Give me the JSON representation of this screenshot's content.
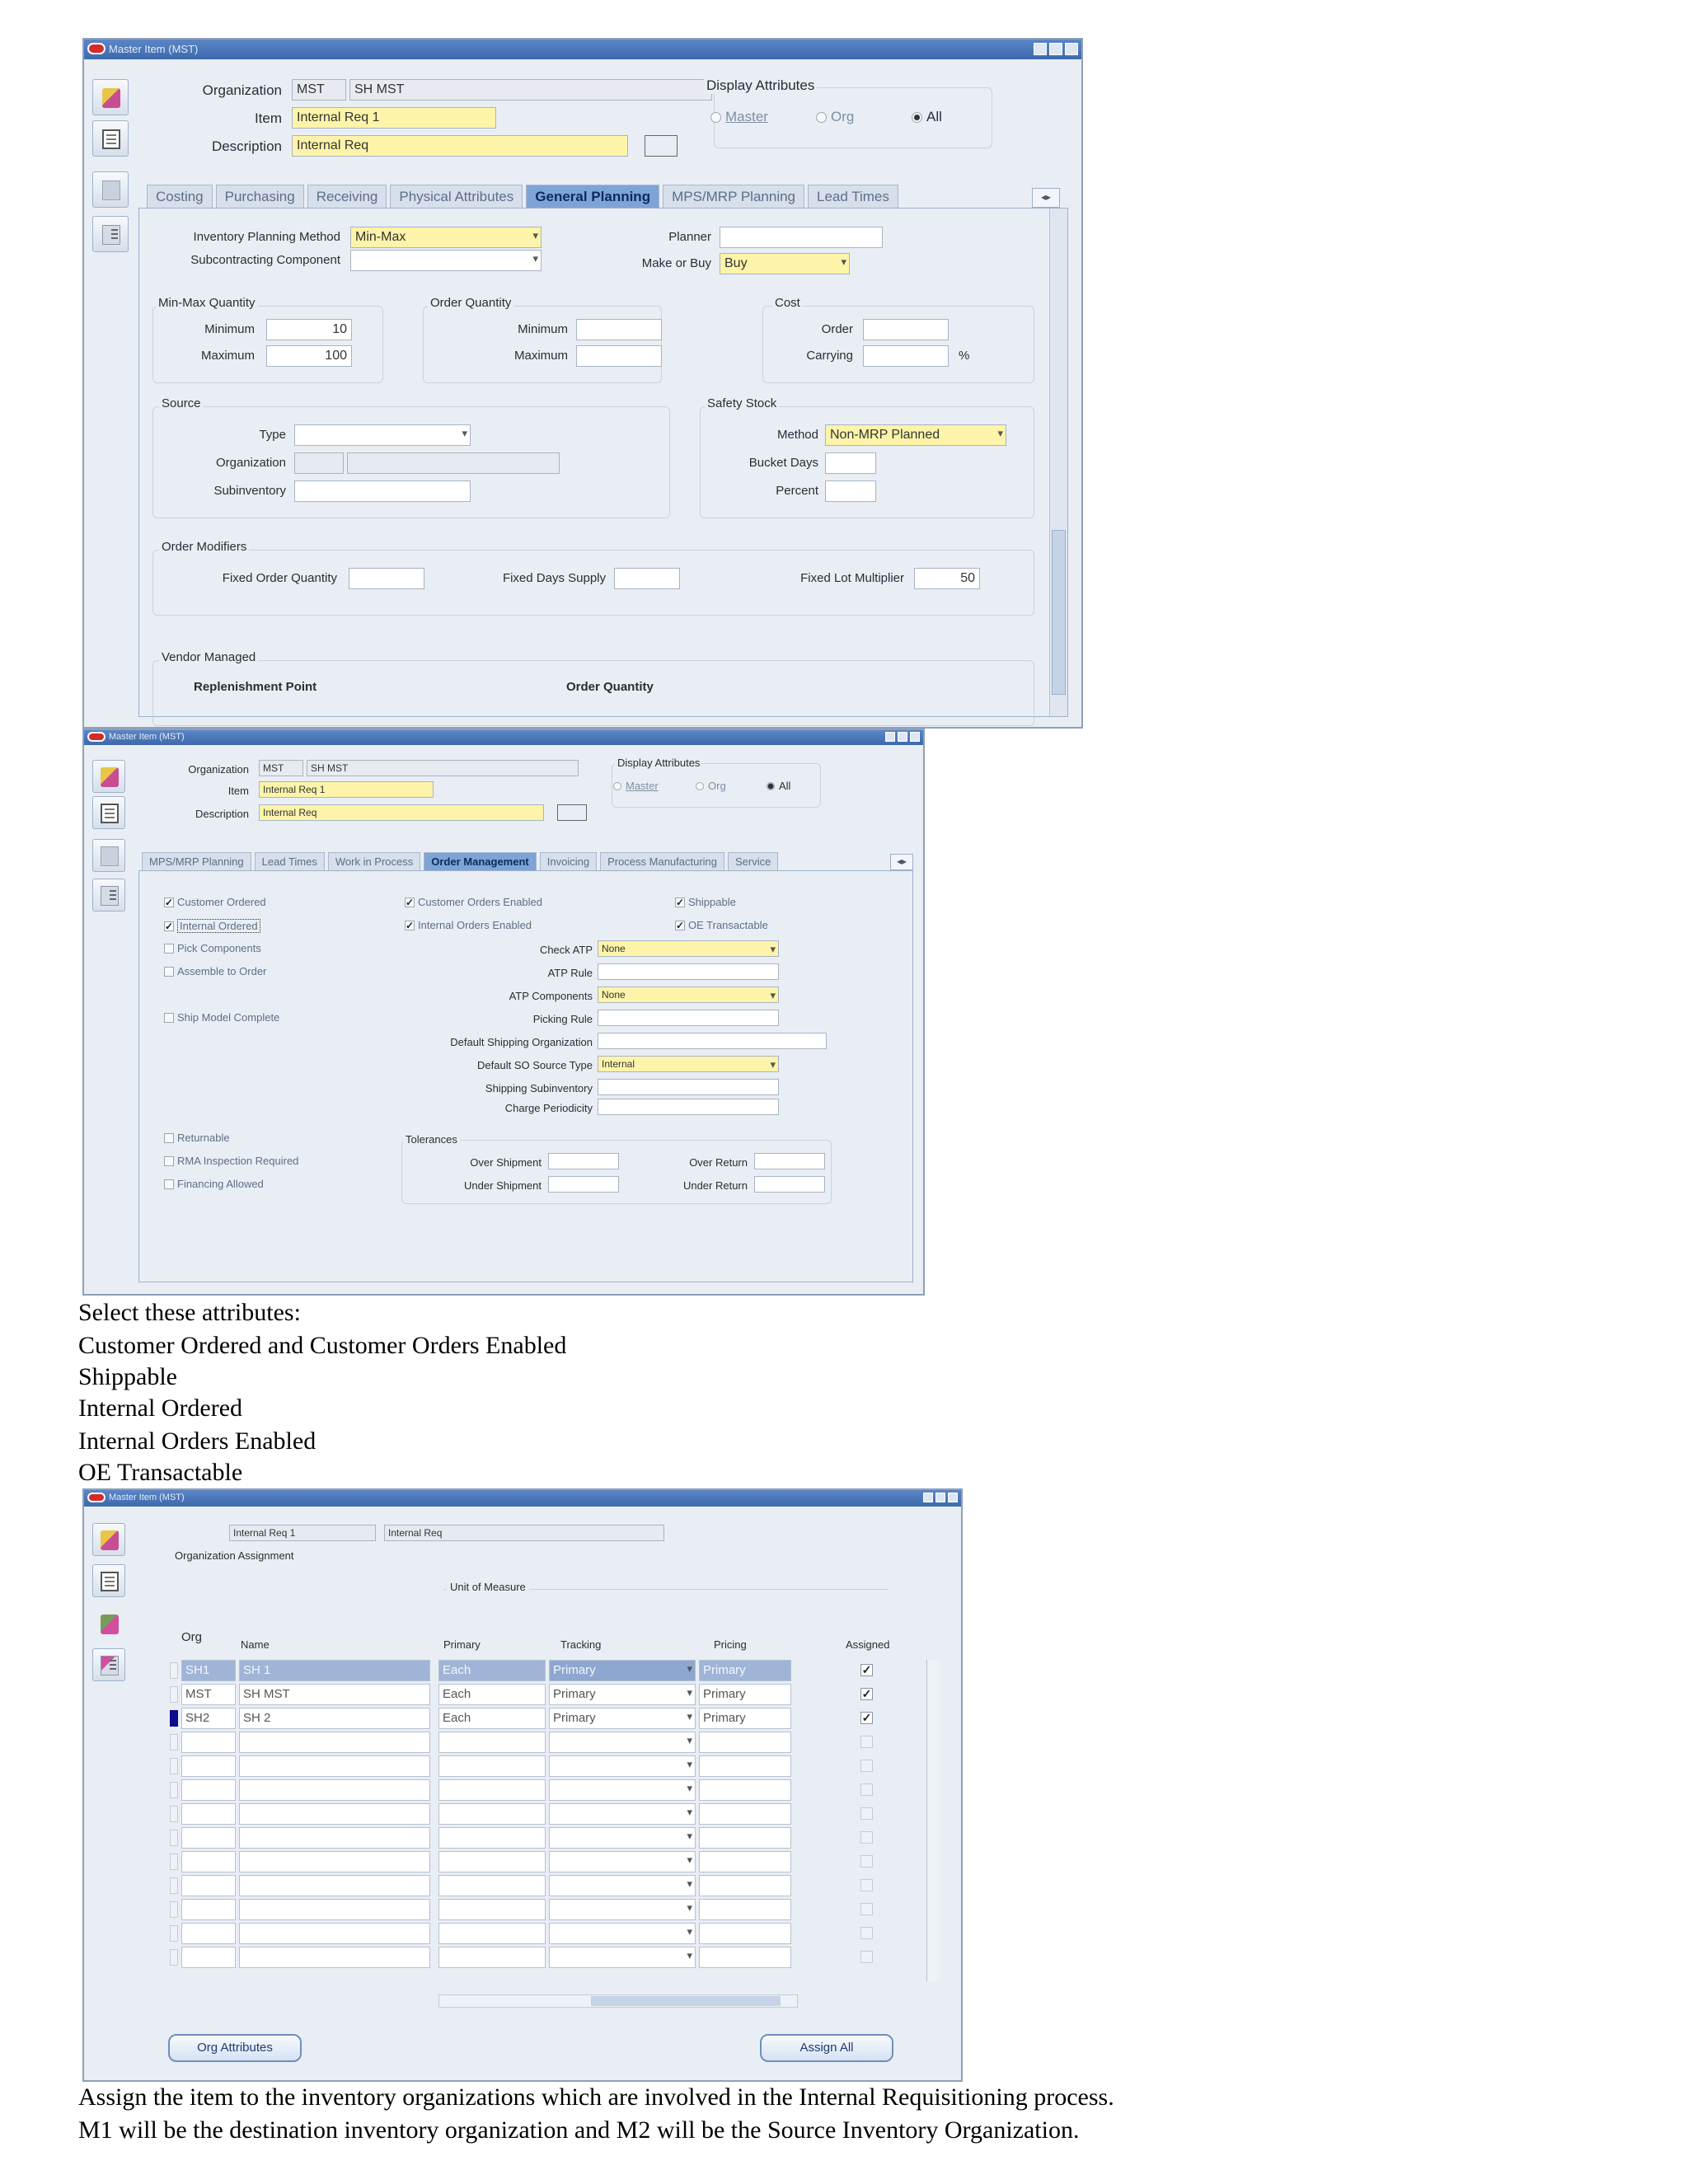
{
  "window1": {
    "title": "Master Item (MST)",
    "org_label": "Organization",
    "org_code": "MST",
    "org_name": "SH MST",
    "item_label": "Item",
    "item_value": "Internal Req 1",
    "desc_label": "Description",
    "desc_value": "Internal Req",
    "display_attributes": {
      "title": "Display Attributes",
      "master": "Master",
      "org": "Org",
      "all": "All",
      "selected": "All"
    },
    "tabs": [
      "Costing",
      "Purchasing",
      "Receiving",
      "Physical Attributes",
      "General Planning",
      "MPS/MRP Planning",
      "Lead Times"
    ],
    "active_tab": "General Planning",
    "nav_button": "◂▸",
    "inventory_planning_method_label": "Inventory Planning Method",
    "inventory_planning_method_value": "Min-Max",
    "subcontracting_label": "Subcontracting Component",
    "subcontracting_value": "",
    "planner_label": "Planner",
    "planner_value": "",
    "make_or_buy_label": "Make or Buy",
    "make_or_buy_value": "Buy",
    "minmax": {
      "title": "Min-Max Quantity",
      "min_label": "Minimum",
      "min_value": "10",
      "max_label": "Maximum",
      "max_value": "100"
    },
    "orderqty": {
      "title": "Order Quantity",
      "min_label": "Minimum",
      "min_value": "",
      "max_label": "Maximum",
      "max_value": ""
    },
    "cost": {
      "title": "Cost",
      "order_label": "Order",
      "order_value": "",
      "carrying_label": "Carrying",
      "carrying_value": "",
      "pct": "%"
    },
    "source": {
      "title": "Source",
      "type_label": "Type",
      "org_label": "Organization",
      "subinv_label": "Subinventory"
    },
    "safety": {
      "title": "Safety Stock",
      "method_label": "Method",
      "method_value": "Non-MRP Planned",
      "bucket_label": "Bucket Days",
      "percent_label": "Percent"
    },
    "modifiers": {
      "title": "Order Modifiers",
      "foq_label": "Fixed Order Quantity",
      "foq_value": "",
      "fds_label": "Fixed Days Supply",
      "fds_value": "",
      "flm_label": "Fixed Lot Multiplier",
      "flm_value": "50"
    },
    "vendor": {
      "title": "Vendor Managed",
      "replenishment": "Replenishment Point",
      "order_qty": "Order Quantity"
    }
  },
  "window2": {
    "title": "Master Item (MST)",
    "org_label": "Organization",
    "org_code": "MST",
    "org_name": "SH MST",
    "item_label": "Item",
    "item_value": "Internal Req 1",
    "desc_label": "Description",
    "desc_value": "Internal Req",
    "display_attributes": {
      "title": "Display Attributes",
      "master": "Master",
      "org": "Org",
      "all": "All",
      "selected": "All"
    },
    "tabs": [
      "MPS/MRP Planning",
      "Lead Times",
      "Work in Process",
      "Order Management",
      "Invoicing",
      "Process Manufacturing",
      "Service"
    ],
    "active_tab": "Order Management",
    "nav_button": "◂▸",
    "checks": {
      "customer_ordered": {
        "label": "Customer Ordered",
        "checked": true
      },
      "internal_ordered": {
        "label": "Internal Ordered",
        "checked": true
      },
      "pick_components": {
        "label": "Pick Components",
        "checked": false
      },
      "assemble_to_order": {
        "label": "Assemble to Order",
        "checked": false
      },
      "ship_model_complete": {
        "label": "Ship Model Complete",
        "checked": false
      },
      "customer_orders_enabled": {
        "label": "Customer Orders Enabled",
        "checked": true
      },
      "internal_orders_enabled": {
        "label": "Internal Orders Enabled",
        "checked": true
      },
      "shippable": {
        "label": "Shippable",
        "checked": true
      },
      "oe_transactable": {
        "label": "OE Transactable",
        "checked": true
      },
      "returnable": {
        "label": "Returnable",
        "checked": false
      },
      "rma_inspection": {
        "label": "RMA Inspection Required",
        "checked": false
      },
      "financing_allowed": {
        "label": "Financing Allowed",
        "checked": false
      }
    },
    "check_atp_label": "Check ATP",
    "check_atp_value": "None",
    "atp_rule_label": "ATP Rule",
    "atp_components_label": "ATP Components",
    "atp_components_value": "None",
    "picking_rule_label": "Picking Rule",
    "default_shipping_org_label": "Default Shipping Organization",
    "default_so_source_label": "Default SO Source Type",
    "default_so_source_value": "Internal",
    "shipping_subinv_label": "Shipping Subinventory",
    "charge_periodicity_label": "Charge Periodicity",
    "tolerances": {
      "title": "Tolerances",
      "over_shipment": "Over Shipment",
      "under_shipment": "Under Shipment",
      "over_return": "Over Return",
      "under_return": "Under Return"
    }
  },
  "instructions1": {
    "heading": "Select these attributes:",
    "lines": [
      "Customer Ordered and Customer Orders Enabled",
      "Shippable",
      "Internal Ordered",
      "Internal Orders Enabled",
      "OE Transactable"
    ]
  },
  "window3": {
    "title": "Master Item (MST)",
    "item_label": "Item",
    "item_value": "Internal Req 1",
    "item_desc": "Internal Req",
    "org_assignment": "Organization Assignment",
    "uom_header": "Unit of Measure",
    "columns": {
      "org": "Org",
      "name": "Name",
      "primary": "Primary",
      "tracking": "Tracking",
      "pricing": "Pricing",
      "assigned": "Assigned"
    },
    "rows": [
      {
        "org": "SH1",
        "name": "SH 1",
        "primary": "Each",
        "tracking": "Primary",
        "pricing": "Primary",
        "assigned": true
      },
      {
        "org": "MST",
        "name": "SH MST",
        "primary": "Each",
        "tracking": "Primary",
        "pricing": "Primary",
        "assigned": true
      },
      {
        "org": "SH2",
        "name": "SH 2",
        "primary": "Each",
        "tracking": "Primary",
        "pricing": "Primary",
        "assigned": true
      }
    ],
    "empty_rows": 10,
    "org_attributes_button": "Org Attributes",
    "assign_all_button": "Assign All"
  },
  "instructions2": {
    "line1": "Assign the item to the inventory organizations which are involved in the Internal Requisitioning process.",
    "line2": "M1 will be the destination inventory organization and M2 will be the Source Inventory Organization."
  }
}
